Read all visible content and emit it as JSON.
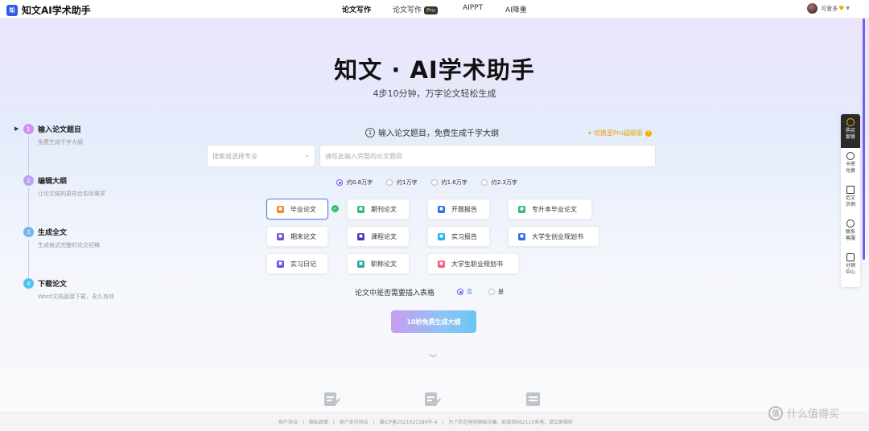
{
  "app": {
    "logo_mark": "知",
    "name": "知文AI学术助手"
  },
  "nav": {
    "items": [
      "论文写作",
      "论文写作",
      "AIPPT",
      "AI降重"
    ],
    "pro_badge": "Pro",
    "active_index": 0
  },
  "user": {
    "name": "可爱多"
  },
  "hero": {
    "title": "知文 · AI学术助手",
    "subtitle": "4步10分钟，万字论文轻松生成"
  },
  "steps": [
    {
      "num": "1",
      "title": "输入论文题目",
      "desc": "免费生成千字大纲",
      "color": "#d48ff0"
    },
    {
      "num": "2",
      "title": "编辑大纲",
      "desc": "让论文结构更符合实际需求",
      "color": "#b9a2ef"
    },
    {
      "num": "3",
      "title": "生成全文",
      "desc": "生成格式完整的论文初稿",
      "color": "#7ab3f0"
    },
    {
      "num": "4",
      "title": "下载论文",
      "desc": "Word文档直接下载，永久有效",
      "color": "#4ec3ef"
    }
  ],
  "form": {
    "step_label": "输入论文题目，免费生成千字大纲",
    "info_icon": "1",
    "pro_switch": "切换至Pro超级版",
    "major_placeholder": "搜索或选择专业",
    "title_placeholder": "请在此输入完整的论文题目",
    "word_counts": [
      "约0.8万字",
      "约1万字",
      "约1.6万字",
      "约2.3万字"
    ],
    "word_count_selected": 0,
    "paper_types": [
      {
        "label": "毕业论文",
        "color": "#f08c1c"
      },
      {
        "label": "期刊论文",
        "color": "#2fbf71"
      },
      {
        "label": "开题报告",
        "color": "#2f6fe8"
      },
      {
        "label": "专升本毕业论文",
        "color": "#2fbf71"
      },
      {
        "label": "期末论文",
        "color": "#7a4fd8"
      },
      {
        "label": "课程论文",
        "color": "#4338b8"
      },
      {
        "label": "实习报告",
        "color": "#22b3e8"
      },
      {
        "label": "大学生创业规划书",
        "color": "#2f6fe8"
      },
      {
        "label": "实习日记",
        "color": "#6a4ff0"
      },
      {
        "label": "职称论文",
        "color": "#2aa6a0"
      },
      {
        "label": "大学生职业规划书",
        "color": "#f0607a"
      }
    ],
    "selected_type": 0,
    "table_question": "论文中是否需要插入表格",
    "table_options": [
      "否",
      "是"
    ],
    "table_selected": 0,
    "generate_button": "10秒免费生成大纲"
  },
  "sidebar": {
    "items": [
      {
        "label": "购买套餐",
        "lines": [
          "购买",
          "套餐"
        ]
      },
      {
        "label": "卡密兑换",
        "lines": [
          "卡密",
          "兑换"
        ]
      },
      {
        "label": "范文示例",
        "lines": [
          "范文",
          "示例"
        ]
      },
      {
        "label": "联系客服",
        "lines": [
          "联系",
          "客服"
        ]
      },
      {
        "label": "分销中心",
        "lines": [
          "分销",
          "中心"
        ]
      }
    ]
  },
  "footer": {
    "links": [
      "用户协议",
      "|",
      "隐私政策",
      "|",
      "用户支付协议",
      "|",
      "蜀ICP备2021021389号-4",
      "|",
      "为了防范电信网络诈骗，如接到962110来电，请立即接听"
    ]
  },
  "watermark": {
    "icon": "值",
    "text": "什么值得买"
  },
  "colors": {
    "accent": "#6a55e8",
    "selected_border": "#4a78e8",
    "pro": "#e8a100"
  }
}
